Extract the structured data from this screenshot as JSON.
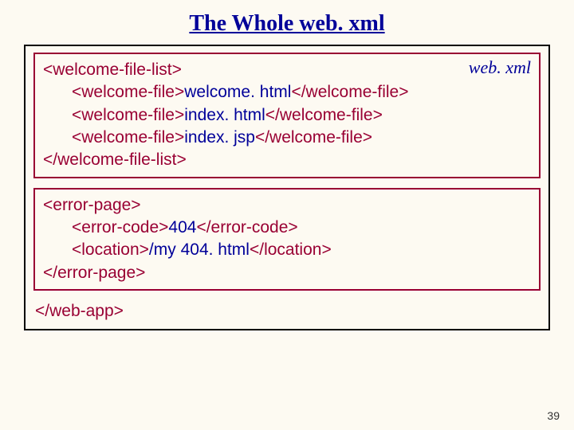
{
  "title": "The Whole web. xml",
  "float_label": "web. xml",
  "box1": {
    "l1a": "<welcome-file-list>",
    "l2a": "<welcome-file>",
    "l2b": "welcome. html",
    "l2c": "</welcome-file>",
    "l3a": "<welcome-file>",
    "l3b": "index. html",
    "l3c": "</welcome-file>",
    "l4a": "<welcome-file>",
    "l4b": "index. jsp",
    "l4c": "</welcome-file>",
    "l5a": "</welcome-file-list>"
  },
  "box2": {
    "l1a": "<error-page>",
    "l2a": "<error-code>",
    "l2b": "404",
    "l2c": "</error-code>",
    "l3a": "<location>",
    "l3b": "/my 404. html",
    "l3c": "</location>",
    "l4a": "</error-page>"
  },
  "closing": "</web-app>",
  "page_number": "39"
}
